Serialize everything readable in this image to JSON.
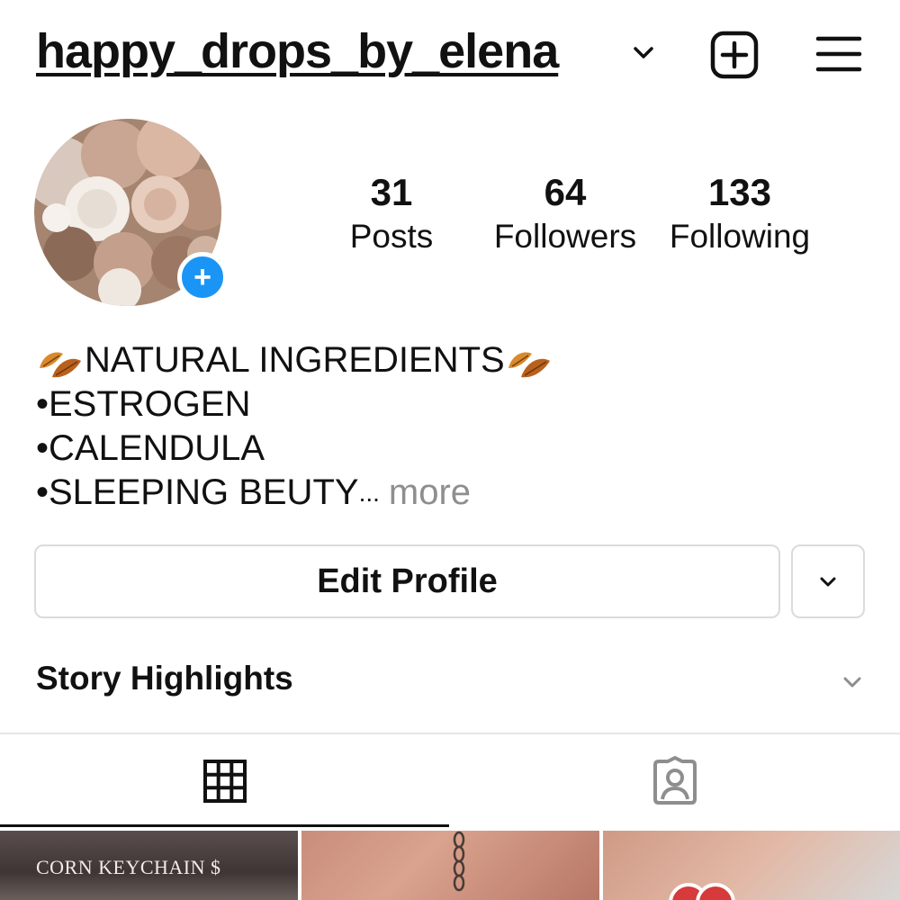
{
  "header": {
    "username": "happy_drops_by_elena",
    "icons": [
      "chevron-down-icon",
      "new-post-icon",
      "hamburger-menu-icon"
    ]
  },
  "profile": {
    "avatar_add_label": "+",
    "stats": [
      {
        "value": "31",
        "label": "Posts"
      },
      {
        "value": "64",
        "label": "Followers"
      },
      {
        "value": "133",
        "label": "Following"
      }
    ]
  },
  "bio": {
    "line1": "NATURAL INGREDIENTS",
    "line2": "•ESTROGEN",
    "line3": "•CALENDULA",
    "line4": "•SLEEPING BEUTY",
    "ellipsis": "...",
    "more": "more"
  },
  "actions": {
    "edit_profile": "Edit Profile"
  },
  "highlights": {
    "title": "Story Highlights"
  },
  "tabs": [
    {
      "name": "grid",
      "icon": "grid-icon",
      "active": true
    },
    {
      "name": "tagged",
      "icon": "tagged-person-icon",
      "active": false
    }
  ],
  "posts": [
    {
      "caption": "CORN KEYCHAIN $"
    },
    {
      "caption": ""
    },
    {
      "caption": ""
    }
  ],
  "colors": {
    "accent_blue": "#1b95f5",
    "border": "#dbdbdb",
    "muted_text": "#8e8e8e",
    "leaf_orange": "#c8741f"
  }
}
